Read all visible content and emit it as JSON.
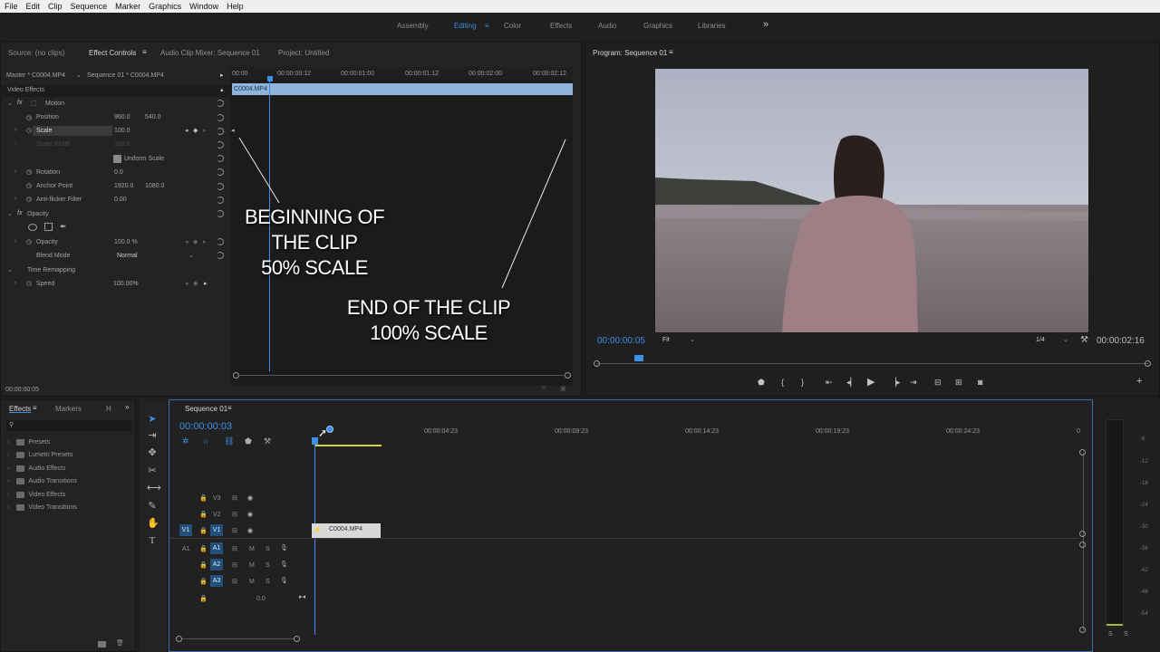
{
  "menu": [
    "File",
    "Edit",
    "Clip",
    "Sequence",
    "Marker",
    "Graphics",
    "Window",
    "Help"
  ],
  "workspaces": {
    "items": [
      "Assembly",
      "Editing",
      "Color",
      "Effects",
      "Audio",
      "Graphics",
      "Libraries"
    ],
    "active": "Editing",
    "more": "»"
  },
  "source_tabs": {
    "source": "Source: (no clips)",
    "effect_controls": "Effect Controls",
    "audio_mixer": "Audio Clip Mixer: Sequence 01",
    "project": "Project: Untitled"
  },
  "effect_controls": {
    "master": "Master * C0004.MP4",
    "sequence_clip": "Sequence 01 * C0004.MP4",
    "ruler": [
      "00:00",
      "00:00:00:12",
      "00:00:01:00",
      "00:00:01:12",
      "00:00:02:00",
      "00:00:02:12"
    ],
    "clip_name": "C0004.MP4",
    "video_effects": "Video Effects",
    "motion": "Motion",
    "position_label": "Position",
    "position_x": "960.0",
    "position_y": "540.0",
    "scale_label": "Scale",
    "scale_value": "100.0",
    "scale_width_label": "Scale Width",
    "scale_width_value": "100.0",
    "uniform_scale": "Uniform Scale",
    "rotation_label": "Rotation",
    "rotation_value": "0.0",
    "anchor_label": "Anchor Point",
    "anchor_x": "1920.0",
    "anchor_y": "1080.0",
    "antiflicker_label": "Anti-flicker Filter",
    "antiflicker_value": "0.00",
    "opacity": "Opacity",
    "opacity_label": "Opacity",
    "opacity_value": "100.0 %",
    "blend_label": "Blend Mode",
    "blend_value": "Normal",
    "time_remap": "Time Remapping",
    "speed_label": "Speed",
    "speed_value": "100.00%",
    "timecode": "00:00:00:05"
  },
  "annotations": {
    "beginning": [
      "BEGINNING OF",
      "THE CLIP",
      "50% SCALE"
    ],
    "end": [
      "END OF THE CLIP",
      "100% SCALE"
    ]
  },
  "program": {
    "title": "Program: Sequence 01",
    "timecode": "00:00:00:05",
    "fit": "Fit",
    "quality": "1/4",
    "duration": "00:00:02:16"
  },
  "effects_panel": {
    "tabs": [
      "Effects",
      "Markers",
      "H"
    ],
    "items": [
      "Presets",
      "Lumetri Presets",
      "Audio Effects",
      "Audio Transitions",
      "Video Effects",
      "Video Transitions"
    ]
  },
  "timeline": {
    "title": "Sequence 01",
    "timecode": "00:00:00:03",
    "ruler": [
      "00:00:04:23",
      "00:00:09:23",
      "00:00:14:23",
      "00:00:19:23",
      "00:00:24:23",
      "0"
    ],
    "video_tracks": [
      "V3",
      "V2",
      "V1"
    ],
    "audio_tracks": [
      "A1",
      "A2",
      "A3"
    ],
    "source_v": "V1",
    "source_a": "A1",
    "master_value": "0.0",
    "clip": "C0004.MP4",
    "m": "M",
    "s": "S"
  },
  "meter": {
    "ticks": [
      "-6",
      "-12",
      "-18",
      "-24",
      "-30",
      "-36",
      "-42",
      "-48",
      "-54"
    ],
    "solo": [
      "S",
      "S"
    ]
  },
  "colors": {
    "accent": "#3d8fe6",
    "clip_bar": "#8fb4dc",
    "track_highlight": "#23507a"
  }
}
